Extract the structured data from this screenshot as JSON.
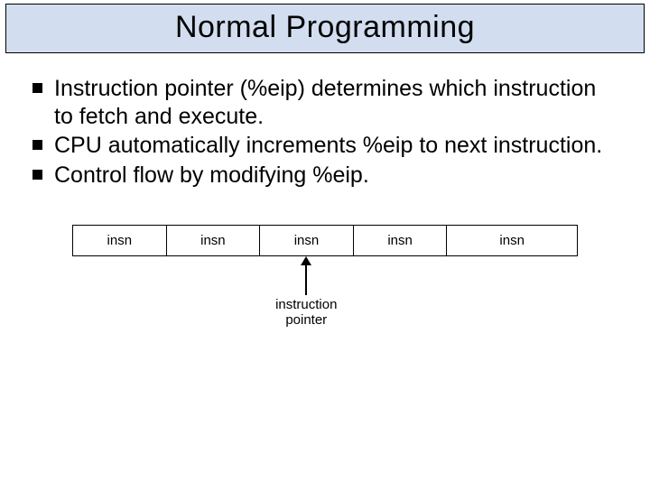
{
  "title": "Normal Programming",
  "bullets": [
    "Instruction pointer (%eip) determines which instruction to fetch and execute.",
    "CPU automatically increments %eip to next instruction.",
    "Control flow by modifying %eip."
  ],
  "diagram": {
    "cells": [
      "insn",
      "insn",
      "insn",
      "insn",
      "insn"
    ],
    "pointer_label_line1": "instruction",
    "pointer_label_line2": "pointer",
    "pointer_index": 2
  }
}
